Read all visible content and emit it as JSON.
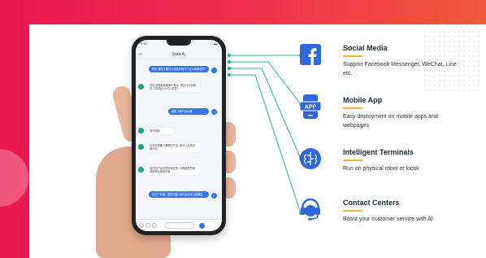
{
  "phone": {
    "status_time": "9:41",
    "status_signal": "••• ▲",
    "status_battery": "▬",
    "chat_title": "Sara A.",
    "messages": [
      {
        "side": "right",
        "text": "你好 我想了解可以优惠吗有什么可以帮助您吗"
      },
      {
        "side": "left",
        "text": "您好 我是智能客服小助手, 很高兴为您服务, 请问有什么可以帮您?"
      },
      {
        "side": "right",
        "text": "我想了解产品价格"
      },
      {
        "side": "left",
        "text": "您好您能"
      },
      {
        "side": "left",
        "text": "请问您需要了解哪些产品, 我可以为您详细介绍"
      },
      {
        "side": "left",
        "text": "我们的产品有很多种类型, 可根据您的需求推荐合适的方案"
      },
      {
        "side": "right",
        "text": "请在下方输入您的问题, 我们会尽快为您解答"
      }
    ],
    "input_placeholder": ""
  },
  "channels": [
    {
      "title": "Social Media",
      "desc": "Support Facebook Messenger, WeChat, Line etc.",
      "icon": "facebook-icon"
    },
    {
      "title": "Mobile App",
      "desc": "Easy deployment on mobile apps and webpages",
      "icon": "app-icon"
    },
    {
      "title": "Intelligent Terminals",
      "desc": "Run on physical robot or kiosk",
      "icon": "brain-icon"
    },
    {
      "title": "Contact Centers",
      "desc": "Boost your customer service with AI",
      "icon": "headset-icon"
    }
  ],
  "colors": {
    "accent": "#e8174f",
    "blue": "#2f67d8",
    "teal": "#2bb89a",
    "gold": "#f2b233"
  }
}
